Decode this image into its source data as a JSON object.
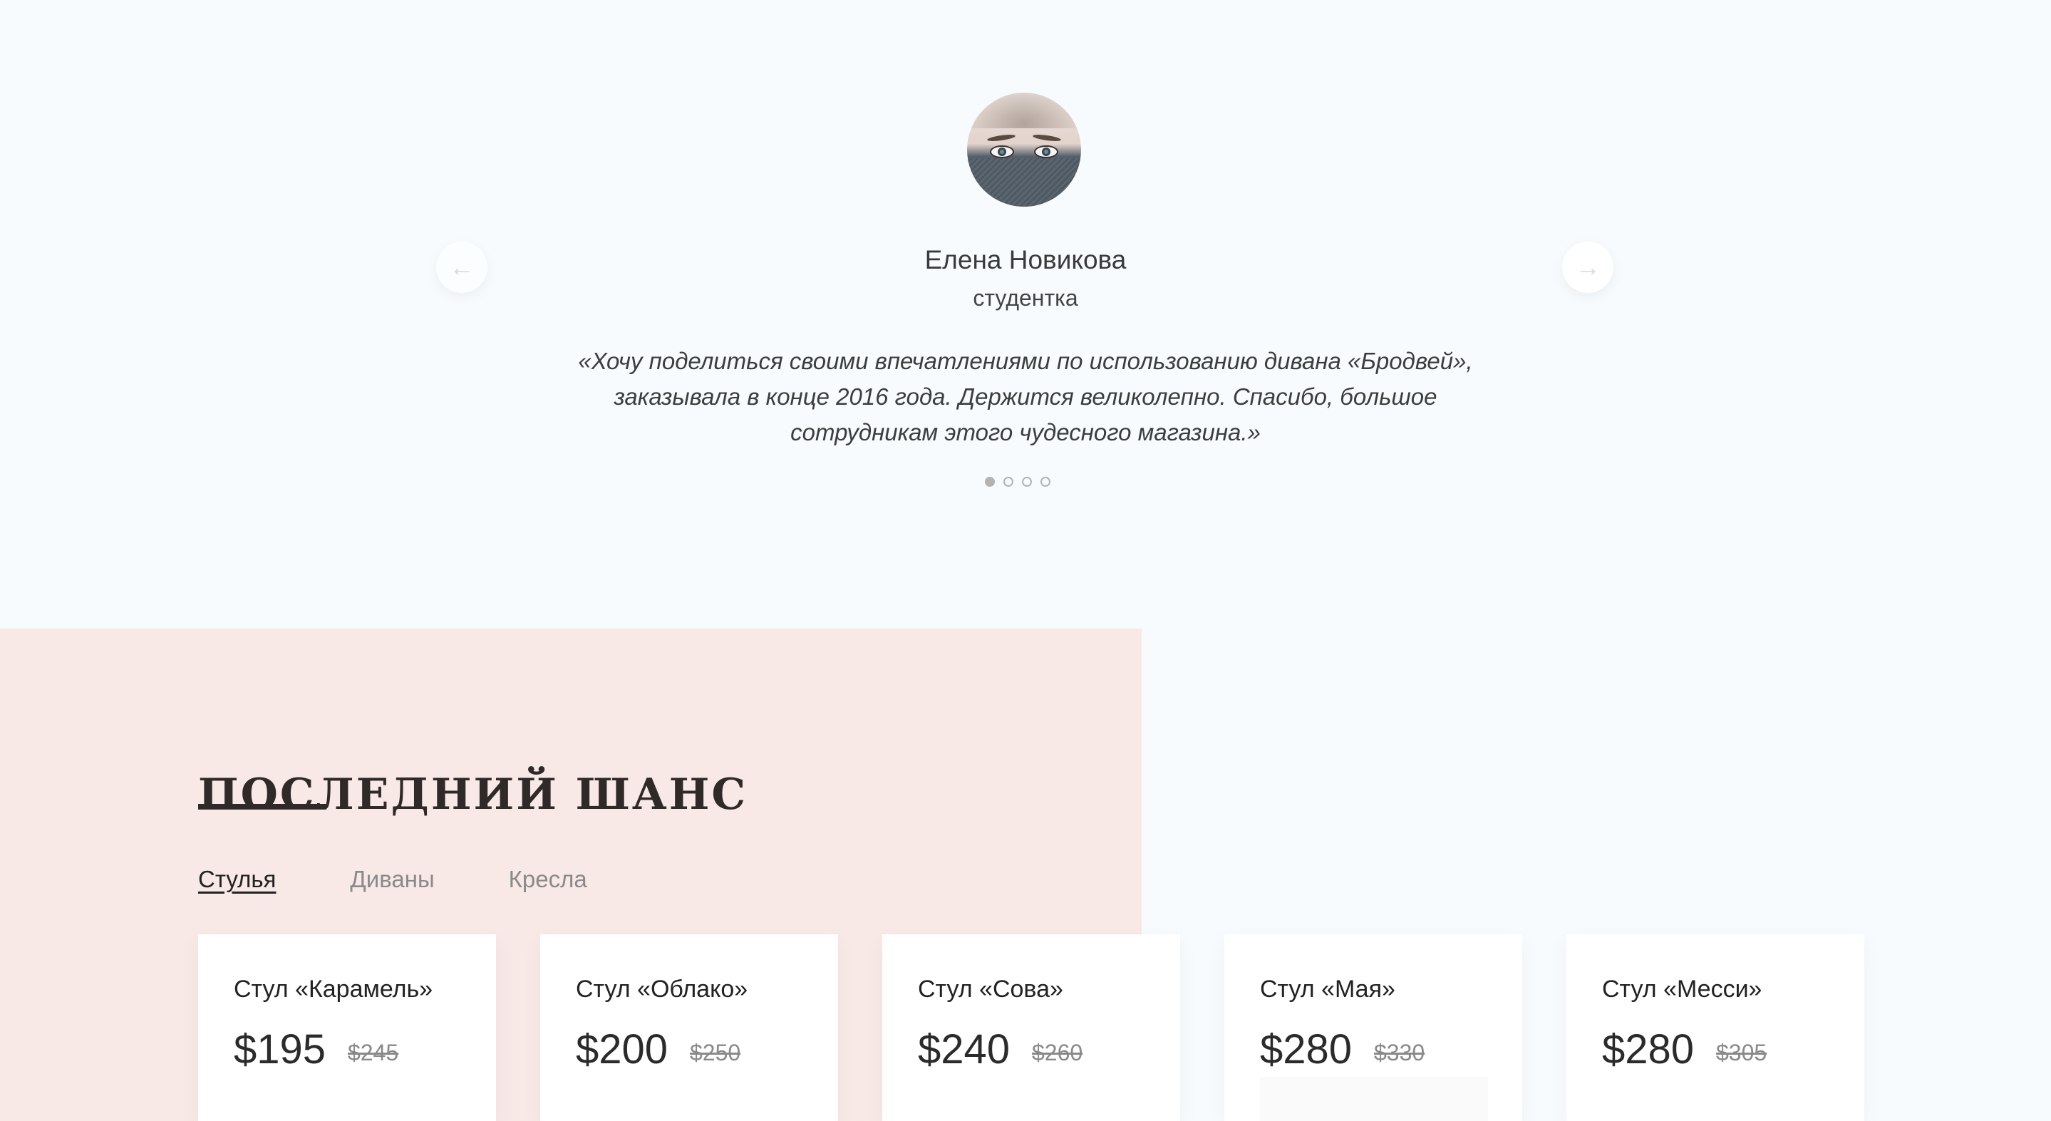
{
  "testimonial": {
    "name": "Елена Новикова",
    "role": "студентка",
    "quote": "«Хочу поделиться своими впечатлениями по использованию дивана «Бродвей», заказывала в конце 2016 года. Держится великолепно. Спасибо, большое сотрудникам этого чудесного магазина.»",
    "prev_icon": "←",
    "next_icon": "→",
    "dots_total": 4,
    "active_dot": 1
  },
  "last_chance": {
    "title": "ПОСЛЕДНИЙ ШАНС",
    "tabs": [
      {
        "label": "Стулья",
        "active": true
      },
      {
        "label": "Диваны",
        "active": false
      },
      {
        "label": "Кресла",
        "active": false
      }
    ],
    "products": [
      {
        "name": "Стул «Карамель»",
        "price": "$195",
        "old_price": "$245"
      },
      {
        "name": "Стул «Облако»",
        "price": "$200",
        "old_price": "$250"
      },
      {
        "name": "Стул «Сова»",
        "price": "$240",
        "old_price": "$260"
      },
      {
        "name": "Стул «Мая»",
        "price": "$280",
        "old_price": "$330"
      },
      {
        "name": "Стул «Месси»",
        "price": "$280",
        "old_price": "$305"
      }
    ]
  },
  "colors": {
    "page_bg": "#f8fbfd",
    "panel_bg": "#f8e9e6",
    "title": "#2f2a28"
  }
}
